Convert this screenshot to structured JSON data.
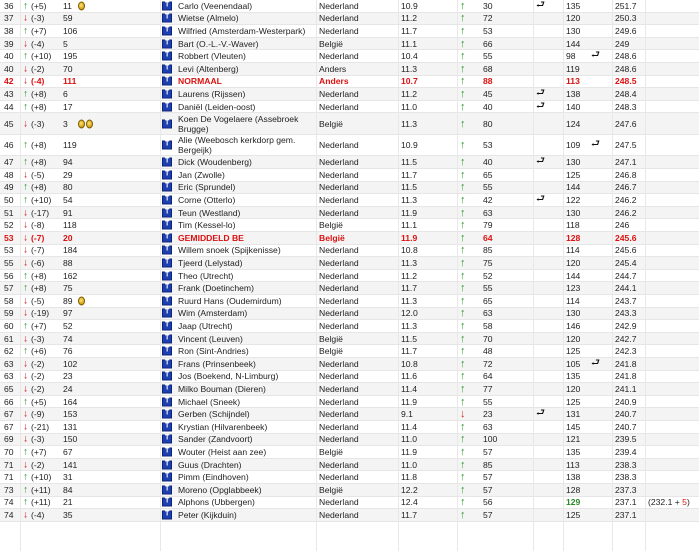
{
  "rows": [
    {
      "rank": "36",
      "dir": "up",
      "delta": "(+5)",
      "prev": "11",
      "medals": 1,
      "name": "Carlo (Veenendaal)",
      "country": "Nederland",
      "score": "10.9",
      "trend": "up",
      "n1": "30",
      "ret": true,
      "n2": "135",
      "pts": "251.7"
    },
    {
      "rank": "37",
      "dir": "down",
      "delta": "(-3)",
      "prev": "59",
      "name": "Wietse (Almelo)",
      "country": "Nederland",
      "score": "11.2",
      "trend": "up",
      "n1": "72",
      "n2": "120",
      "pts": "250.3"
    },
    {
      "rank": "38",
      "dir": "up",
      "delta": "(+7)",
      "prev": "106",
      "name": "Wilfried (Amsterdam-Westerpark)",
      "country": "Nederland",
      "score": "11.7",
      "trend": "up",
      "n1": "53",
      "n2": "130",
      "pts": "249.6"
    },
    {
      "rank": "39",
      "dir": "down",
      "delta": "(-4)",
      "prev": "5",
      "name": "Bart (O.-L.-V.-Waver)",
      "country": "België",
      "score": "11.1",
      "trend": "up",
      "n1": "66",
      "n2": "144",
      "pts": "249"
    },
    {
      "rank": "40",
      "dir": "up",
      "delta": "(+10)",
      "prev": "195",
      "name": "Robbert (Vleuten)",
      "country": "Nederland",
      "score": "10.4",
      "trend": "up",
      "n1": "55",
      "n2": "98",
      "ret2": true,
      "pts": "248.6"
    },
    {
      "rank": "40",
      "dir": "down",
      "delta": "(-2)",
      "prev": "70",
      "name": "Levi (Altenberg)",
      "country": "Anders",
      "score": "11.3",
      "trend": "up",
      "n1": "68",
      "n2": "119",
      "pts": "248.6"
    },
    {
      "rank": "42",
      "dir": "down",
      "delta": "(-4)",
      "prev": "111",
      "special": true,
      "name": "NORMAAL",
      "country": "Anders",
      "score": "10.7",
      "trend": "up",
      "n1": "88",
      "n2": "113",
      "pts": "248.5"
    },
    {
      "rank": "43",
      "dir": "up",
      "delta": "(+8)",
      "prev": "6",
      "name": "Laurens (Rijssen)",
      "country": "Nederland",
      "score": "11.2",
      "trend": "up",
      "n1": "45",
      "ret": true,
      "n2": "138",
      "pts": "248.4"
    },
    {
      "rank": "44",
      "dir": "up",
      "delta": "(+8)",
      "prev": "17",
      "name": "Daniël (Leiden-oost)",
      "country": "Nederland",
      "score": "11.0",
      "trend": "up",
      "n1": "40",
      "ret": true,
      "n2": "140",
      "pts": "248.3"
    },
    {
      "rank": "45",
      "dir": "down",
      "delta": "(-3)",
      "prev": "3",
      "medals": 2,
      "two": true,
      "name": "Koen De Vogelaere (Assebroek Brugge)",
      "country": "België",
      "score": "11.3",
      "trend": "up",
      "n1": "80",
      "n2": "124",
      "pts": "247.6"
    },
    {
      "rank": "46",
      "dir": "up",
      "delta": "(+8)",
      "prev": "119",
      "two": true,
      "name": "Alie (Weebosch kerkdorp gem. Bergeijk)",
      "country": "Nederland",
      "score": "10.9",
      "trend": "up",
      "n1": "53",
      "n2": "109",
      "ret2": true,
      "pts": "247.5"
    },
    {
      "rank": "47",
      "dir": "up",
      "delta": "(+8)",
      "prev": "94",
      "name": "Dick (Woudenberg)",
      "country": "Nederland",
      "score": "11.5",
      "trend": "up",
      "n1": "40",
      "ret": true,
      "n2": "130",
      "pts": "247.1"
    },
    {
      "rank": "48",
      "dir": "down",
      "delta": "(-5)",
      "prev": "29",
      "name": "Jan (Zwolle)",
      "country": "Nederland",
      "score": "11.7",
      "trend": "up",
      "n1": "65",
      "n2": "125",
      "pts": "246.8"
    },
    {
      "rank": "49",
      "dir": "up",
      "delta": "(+8)",
      "prev": "80",
      "name": "Eric (Sprundel)",
      "country": "Nederland",
      "score": "11.5",
      "trend": "up",
      "n1": "55",
      "n2": "144",
      "pts": "246.7"
    },
    {
      "rank": "50",
      "dir": "up",
      "delta": "(+10)",
      "prev": "54",
      "name": "Corne (Otterlo)",
      "country": "Nederland",
      "score": "11.3",
      "trend": "up",
      "n1": "42",
      "ret": true,
      "n2": "122",
      "pts": "246.2"
    },
    {
      "rank": "51",
      "dir": "down",
      "delta": "(-17)",
      "prev": "91",
      "name": "Teun (Westland)",
      "country": "Nederland",
      "score": "11.9",
      "trend": "up",
      "n1": "63",
      "n2": "130",
      "pts": "246.2"
    },
    {
      "rank": "52",
      "dir": "down",
      "delta": "(-8)",
      "prev": "118",
      "name": "Tim (Kessel-lo)",
      "country": "België",
      "score": "11.1",
      "trend": "up",
      "n1": "79",
      "n2": "118",
      "pts": "246"
    },
    {
      "rank": "53",
      "dir": "down",
      "delta": "(-7)",
      "prev": "20",
      "special": true,
      "name": "GEMIDDELD BE",
      "country": "België",
      "score": "11.9",
      "trend": "up",
      "n1": "64",
      "n2": "128",
      "pts": "245.6"
    },
    {
      "rank": "53",
      "dir": "down",
      "delta": "(-7)",
      "prev": "184",
      "name": "Willem snoek (Spijkenisse)",
      "country": "Nederland",
      "score": "10.8",
      "trend": "up",
      "n1": "85",
      "n2": "114",
      "pts": "245.6"
    },
    {
      "rank": "55",
      "dir": "down",
      "delta": "(-6)",
      "prev": "88",
      "name": "Tjeerd (Lelystad)",
      "country": "Nederland",
      "score": "11.3",
      "trend": "up",
      "n1": "75",
      "n2": "120",
      "pts": "245.4"
    },
    {
      "rank": "56",
      "dir": "up",
      "delta": "(+8)",
      "prev": "162",
      "name": "Theo (Utrecht)",
      "country": "Nederland",
      "score": "11.2",
      "trend": "up",
      "n1": "52",
      "n2": "144",
      "pts": "244.7"
    },
    {
      "rank": "57",
      "dir": "up",
      "delta": "(+8)",
      "prev": "75",
      "name": "Frank (Doetinchem)",
      "country": "Nederland",
      "score": "11.7",
      "trend": "up",
      "n1": "55",
      "n2": "123",
      "pts": "244.1"
    },
    {
      "rank": "58",
      "dir": "down",
      "delta": "(-5)",
      "prev": "89",
      "medals": 1,
      "name": "Ruurd Hans (Oudemirdum)",
      "country": "Nederland",
      "score": "11.3",
      "trend": "up",
      "n1": "65",
      "n2": "114",
      "pts": "243.7"
    },
    {
      "rank": "59",
      "dir": "down",
      "delta": "(-19)",
      "prev": "97",
      "name": "Wim (Amsterdam)",
      "country": "Nederland",
      "score": "12.0",
      "trend": "up",
      "n1": "63",
      "n2": "130",
      "pts": "243.3"
    },
    {
      "rank": "60",
      "dir": "up",
      "delta": "(+7)",
      "prev": "52",
      "name": "Jaap (Utrecht)",
      "country": "Nederland",
      "score": "11.3",
      "trend": "up",
      "n1": "58",
      "n2": "146",
      "pts": "242.9"
    },
    {
      "rank": "61",
      "dir": "down",
      "delta": "(-3)",
      "prev": "74",
      "name": "Vincent (Leuven)",
      "country": "België",
      "score": "11.5",
      "trend": "up",
      "n1": "70",
      "n2": "120",
      "pts": "242.7"
    },
    {
      "rank": "62",
      "dir": "up",
      "delta": "(+6)",
      "prev": "76",
      "name": "Ron (Sint-Andries)",
      "country": "België",
      "score": "11.7",
      "trend": "up",
      "n1": "48",
      "n2": "125",
      "pts": "242.3"
    },
    {
      "rank": "63",
      "dir": "down",
      "delta": "(-2)",
      "prev": "102",
      "name": "Frans (Prinsenbeek)",
      "country": "Nederland",
      "score": "10.8",
      "trend": "up",
      "n1": "72",
      "n2": "105",
      "ret2": true,
      "pts": "241.8"
    },
    {
      "rank": "63",
      "dir": "down",
      "delta": "(-2)",
      "prev": "23",
      "name": "Jos (Boekend, N-Limburg)",
      "country": "Nederland",
      "score": "11.6",
      "trend": "up",
      "n1": "64",
      "n2": "135",
      "pts": "241.8"
    },
    {
      "rank": "65",
      "dir": "down",
      "delta": "(-2)",
      "prev": "24",
      "name": "Milko Bouman (Dieren)",
      "country": "Nederland",
      "score": "11.4",
      "trend": "up",
      "n1": "77",
      "n2": "120",
      "pts": "241.1"
    },
    {
      "rank": "66",
      "dir": "up",
      "delta": "(+5)",
      "prev": "164",
      "name": "Michael (Sneek)",
      "country": "Nederland",
      "score": "11.9",
      "trend": "up",
      "n1": "55",
      "n2": "125",
      "pts": "240.9"
    },
    {
      "rank": "67",
      "dir": "down",
      "delta": "(-9)",
      "prev": "153",
      "name": "Gerben (Schijndel)",
      "country": "Nederland",
      "score": "9.1",
      "trend": "down",
      "n1": "23",
      "ret": true,
      "n2": "131",
      "pts": "240.7"
    },
    {
      "rank": "67",
      "dir": "down",
      "delta": "(-21)",
      "prev": "131",
      "name": "Krystian (Hilvarenbeek)",
      "country": "Nederland",
      "score": "11.4",
      "trend": "up",
      "n1": "63",
      "n2": "145",
      "pts": "240.7"
    },
    {
      "rank": "69",
      "dir": "down",
      "delta": "(-3)",
      "prev": "150",
      "name": "Sander (Zandvoort)",
      "country": "Nederland",
      "score": "11.0",
      "trend": "up",
      "n1": "100",
      "n2": "121",
      "pts": "239.5"
    },
    {
      "rank": "70",
      "dir": "up",
      "delta": "(+7)",
      "prev": "67",
      "name": "Wouter (Heist aan zee)",
      "country": "België",
      "score": "11.9",
      "trend": "up",
      "n1": "57",
      "n2": "135",
      "pts": "239.4"
    },
    {
      "rank": "71",
      "dir": "down",
      "delta": "(-2)",
      "prev": "141",
      "name": "Guus (Drachten)",
      "country": "Nederland",
      "score": "11.0",
      "trend": "up",
      "n1": "85",
      "n2": "113",
      "pts": "238.3"
    },
    {
      "rank": "71",
      "dir": "up",
      "delta": "(+10)",
      "prev": "31",
      "name": "Pimm (Eindhoven)",
      "country": "Nederland",
      "score": "11.8",
      "trend": "up",
      "n1": "57",
      "n2": "138",
      "pts": "238.3"
    },
    {
      "rank": "73",
      "dir": "up",
      "delta": "(+11)",
      "prev": "84",
      "name": "Moreno (Opglabbeek)",
      "country": "België",
      "score": "12.2",
      "trend": "up",
      "n1": "57",
      "n2": "128",
      "pts": "237.3"
    },
    {
      "rank": "74",
      "dir": "up",
      "delta": "(+11)",
      "prev": "21",
      "name": "Alphons (Ubbergen)",
      "country": "Nederland",
      "score": "12.4",
      "trend": "up",
      "n1": "56",
      "n2": "129",
      "n2green": true,
      "pts": "237.1",
      "extra": "(232.1 + ",
      "extraplus": "5",
      "extraend": ")"
    },
    {
      "rank": "74",
      "dir": "down",
      "delta": "(-4)",
      "prev": "35",
      "name": "Peter (Kijkduin)",
      "country": "Nederland",
      "score": "11.7",
      "trend": "up",
      "n1": "57",
      "n2": "125",
      "pts": "237.1"
    }
  ]
}
